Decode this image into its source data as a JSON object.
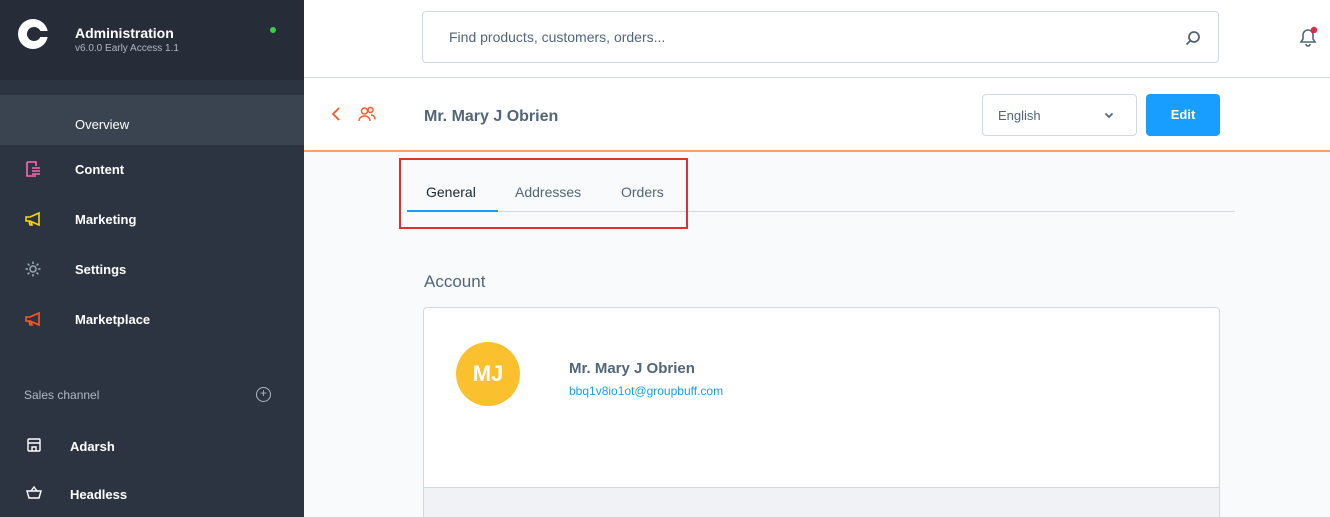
{
  "sidebar": {
    "title": "Administration",
    "version": "v6.0.0 Early Access 1.1",
    "overview": "Overview",
    "items": [
      {
        "label": "Content",
        "icon": "content-icon",
        "color": "#ff68b4"
      },
      {
        "label": "Marketing",
        "icon": "megaphone-icon",
        "color": "#ffd700"
      },
      {
        "label": "Settings",
        "icon": "gear-icon",
        "color": "#9aa8b5"
      },
      {
        "label": "Marketplace",
        "icon": "megaphone-icon",
        "color": "#ff5722"
      }
    ],
    "section_label": "Sales channel",
    "add_symbol": "+",
    "channels": [
      {
        "label": "Adarsh",
        "icon": "storefront-icon"
      },
      {
        "label": "Headless",
        "icon": "basket-icon"
      }
    ]
  },
  "topbar": {
    "search_placeholder": "Find products, customers, orders..."
  },
  "smartbar": {
    "title": "Mr. Mary J Obrien",
    "language": "English",
    "edit_label": "Edit"
  },
  "tabs": [
    {
      "label": "General",
      "active": true
    },
    {
      "label": "Addresses",
      "active": false
    },
    {
      "label": "Orders",
      "active": false
    }
  ],
  "account": {
    "section_title": "Account",
    "initials": "MJ",
    "name": "Mr. Mary J Obrien",
    "email": "bbq1v8io1ot@groupbuff.com"
  },
  "colors": {
    "accent": "#189eff",
    "avatar": "#fbc02d",
    "highlight": "#e52f2f"
  }
}
